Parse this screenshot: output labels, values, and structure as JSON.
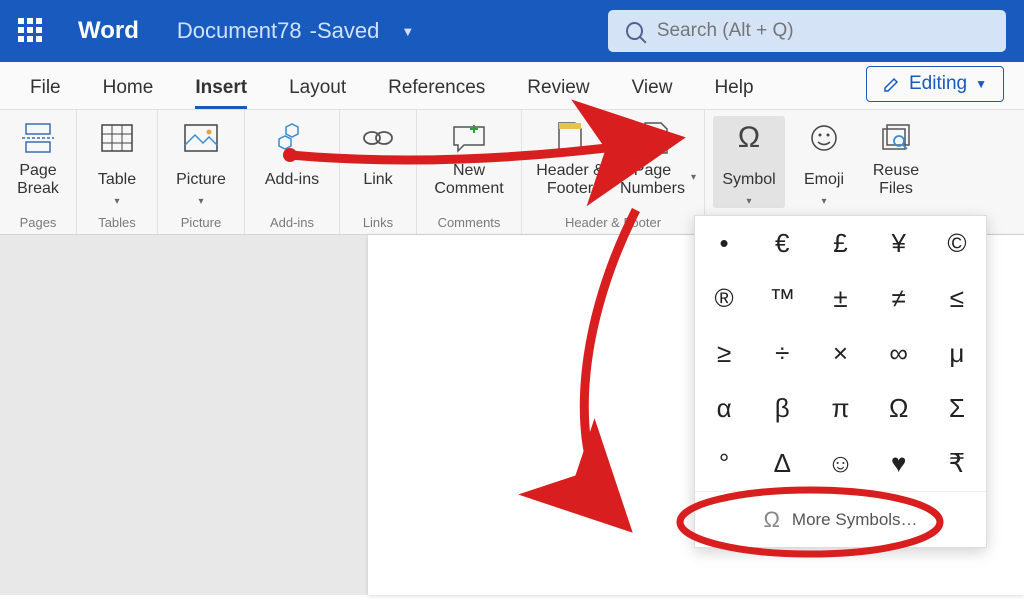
{
  "titlebar": {
    "app_name": "Word",
    "doc_name": "Document78",
    "status_sep": " - ",
    "status": "Saved",
    "search_placeholder": "Search (Alt + Q)"
  },
  "tabs": [
    "File",
    "Home",
    "Insert",
    "Layout",
    "References",
    "Review",
    "View",
    "Help"
  ],
  "active_tab": "Insert",
  "editing_button": "Editing",
  "ribbon": {
    "groups": [
      {
        "label": "Pages",
        "items": [
          {
            "id": "page-break",
            "label": "Page Break"
          }
        ]
      },
      {
        "label": "Tables",
        "items": [
          {
            "id": "table",
            "label": "Table",
            "dropdown": true
          }
        ]
      },
      {
        "label": "Picture",
        "items": [
          {
            "id": "picture",
            "label": "Picture",
            "dropdown": true
          }
        ]
      },
      {
        "label": "Add-ins",
        "items": [
          {
            "id": "addins",
            "label": "Add-ins"
          }
        ]
      },
      {
        "label": "Links",
        "items": [
          {
            "id": "link",
            "label": "Link"
          }
        ]
      },
      {
        "label": "Comments",
        "items": [
          {
            "id": "new-comment",
            "label": "New Comment"
          }
        ]
      },
      {
        "label": "Header & Footer",
        "items": [
          {
            "id": "header-footer",
            "label": "Header & Footer"
          },
          {
            "id": "page-numbers",
            "label": "Page Numbers",
            "dropdown": true
          }
        ]
      },
      {
        "label": "",
        "items": [
          {
            "id": "symbol",
            "label": "Symbol",
            "dropdown": true,
            "active": true
          },
          {
            "id": "emoji",
            "label": "Emoji",
            "dropdown": true
          },
          {
            "id": "reuse-files",
            "label": "Reuse Files"
          }
        ]
      }
    ]
  },
  "symbol_popup": {
    "symbols": [
      "•",
      "€",
      "£",
      "¥",
      "©",
      "®",
      "™",
      "±",
      "≠",
      "≤",
      "≥",
      "÷",
      "×",
      "∞",
      "μ",
      "α",
      "β",
      "π",
      "Ω",
      "Σ",
      "°",
      "Δ",
      "☺",
      "♥",
      "₹"
    ],
    "more_label": "More Symbols…"
  }
}
